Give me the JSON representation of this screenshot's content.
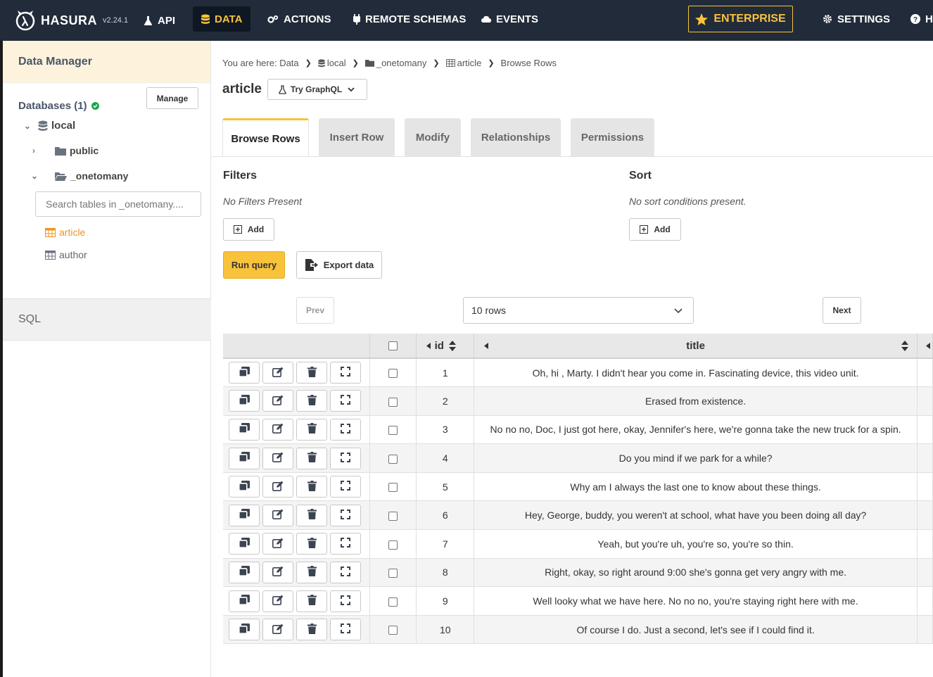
{
  "nav": {
    "brand": "HASURA",
    "version": "v2.24.1",
    "api": "API",
    "data": "DATA",
    "actions": "ACTIONS",
    "remote_schemas": "REMOTE SCHEMAS",
    "events": "EVENTS",
    "enterprise": "ENTERPRISE",
    "settings": "SETTINGS",
    "help": "H",
    "accent": "#f8c33b"
  },
  "sidebar": {
    "title": "Data Manager",
    "databases_label": "Databases (1)",
    "manage": "Manage",
    "db_name": "local",
    "schemas": [
      "public",
      "_onetomany"
    ],
    "search_placeholder": "Search tables in _onetomany....",
    "tables": [
      "article",
      "author"
    ],
    "sql": "SQL"
  },
  "breadcrumb": {
    "prefix": "You are here: Data",
    "items": [
      "local",
      "_onetomany",
      "article",
      "Browse Rows"
    ]
  },
  "page": {
    "title": "article",
    "try_graphql": "Try GraphQL"
  },
  "tabs": [
    "Browse Rows",
    "Insert Row",
    "Modify",
    "Relationships",
    "Permissions"
  ],
  "filters": {
    "title": "Filters",
    "empty": "No Filters Present",
    "add": "Add"
  },
  "sort": {
    "title": "Sort",
    "empty": "No sort conditions present.",
    "add": "Add"
  },
  "run_query": "Run query",
  "export_data": "Export data",
  "pagination": {
    "prev": "Prev",
    "rows": "10 rows",
    "next": "Next"
  },
  "table": {
    "columns": [
      "id",
      "title"
    ],
    "rows": [
      {
        "id": "1",
        "title": "Oh, hi , Marty. I didn't hear you come in. Fascinating device, this video unit."
      },
      {
        "id": "2",
        "title": "Erased from existence."
      },
      {
        "id": "3",
        "title": "No no no, Doc, I just got here, okay, Jennifer's here, we're gonna take the new truck for a spin."
      },
      {
        "id": "4",
        "title": "Do you mind if we park for a while?"
      },
      {
        "id": "5",
        "title": "Why am I always the last one to know about these things."
      },
      {
        "id": "6",
        "title": "Hey, George, buddy, you weren't at school, what have you been doing all day?"
      },
      {
        "id": "7",
        "title": "Yeah, but you're uh, you're so, you're so thin."
      },
      {
        "id": "8",
        "title": "Right, okay, so right around 9:00 she's gonna get very angry with me."
      },
      {
        "id": "9",
        "title": "Well looky what we have here. No no no, you're staying right here with me."
      },
      {
        "id": "10",
        "title": "Of course I do. Just a second, let's see if I could find it."
      }
    ]
  }
}
